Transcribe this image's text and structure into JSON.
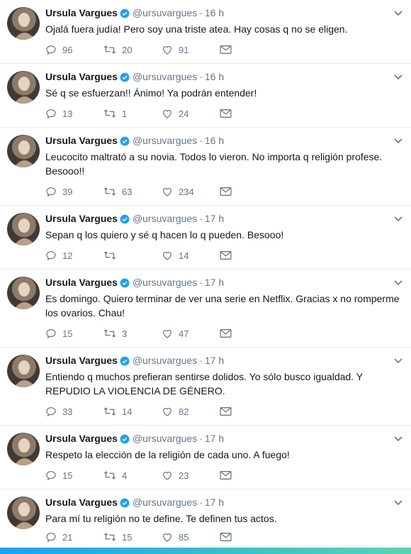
{
  "colors": {
    "verified": "#1da1f2",
    "secondary_text": "#657786",
    "divider": "#e6ecf0"
  },
  "icons": {
    "reply": "reply-icon",
    "retweet": "retweet-icon",
    "like": "heart-icon",
    "dm": "mail-icon",
    "caret": "chevron-down-icon",
    "verified": "verified-badge-icon"
  },
  "tweets": [
    {
      "name": "Ursula Vargues",
      "handle": "@ursuvargues",
      "time": "16 h",
      "text": "Ojalá fuera judía! Pero soy una triste atea. Hay cosas q no se eligen.",
      "replies": "96",
      "retweets": "20",
      "likes": "91"
    },
    {
      "name": "Ursula Vargues",
      "handle": "@ursuvargues",
      "time": "16 h",
      "text": "Sé q se esfuerzan!! Ánimo! Ya podrán entender!",
      "replies": "13",
      "retweets": "1",
      "likes": "24"
    },
    {
      "name": "Ursula Vargues",
      "handle": "@ursuvargues",
      "time": "16 h",
      "text": "Leucocito maltrató a su novia. Todos lo vieron. No importa q religión profese. Besooo!!",
      "replies": "39",
      "retweets": "63",
      "likes": "234"
    },
    {
      "name": "Ursula Vargues",
      "handle": "@ursuvargues",
      "time": "17 h",
      "text": "Sepan q los quiero y sé q hacen lo q pueden. Besooo!",
      "replies": "12",
      "retweets": "",
      "likes": "14"
    },
    {
      "name": "Ursula Vargues",
      "handle": "@ursuvargues",
      "time": "17 h",
      "text": "Es domingo. Quiero terminar de ver una serie en Netflix. Gracias x no romperme los ovarios. Chau!",
      "replies": "15",
      "retweets": "3",
      "likes": "47"
    },
    {
      "name": "Ursula Vargues",
      "handle": "@ursuvargues",
      "time": "17 h",
      "text": "Entiendo q muchos prefieran sentirse dolidos. Yo sólo busco igualdad. Y REPUDIO LA VIOLENCIA DE GÉNERO.",
      "replies": "33",
      "retweets": "14",
      "likes": "82"
    },
    {
      "name": "Ursula Vargues",
      "handle": "@ursuvargues",
      "time": "17 h",
      "text": "Respeto la elección de la religión de cada uno. A fuego!",
      "replies": "15",
      "retweets": "4",
      "likes": "23"
    },
    {
      "name": "Ursula Vargues",
      "handle": "@ursuvargues",
      "time": "17 h",
      "text": "Para mí tu religión no te define. Te definen tus actos.",
      "replies": "21",
      "retweets": "15",
      "likes": "85"
    }
  ]
}
